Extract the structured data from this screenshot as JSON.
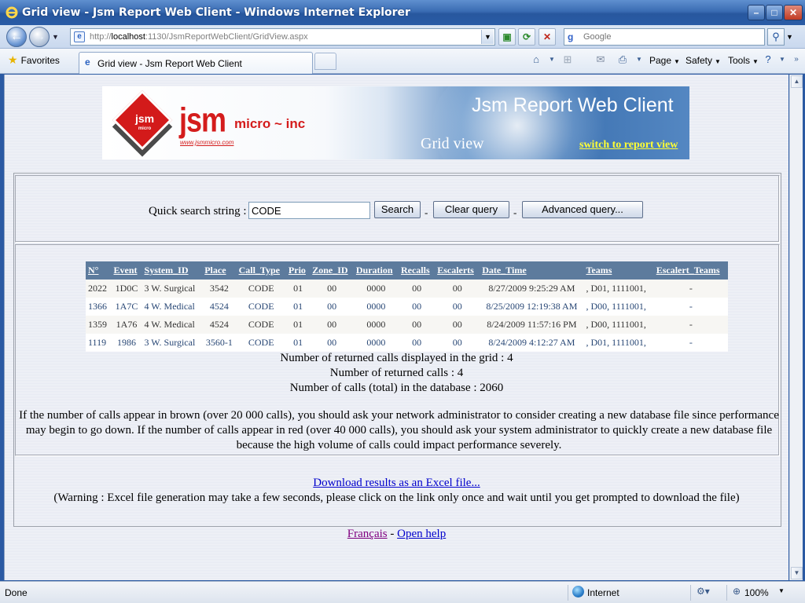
{
  "window": {
    "title": "Grid view - Jsm Report Web Client - Windows Internet Explorer",
    "minimize": "–",
    "maximize": "□",
    "close": "✕"
  },
  "nav": {
    "url_prefix": "http://",
    "url_host": "localhost",
    "url_rest": ":1130/JsmReportWebClient/GridView.aspx",
    "search_placeholder": "Google"
  },
  "commandbar": {
    "favorites": "Favorites",
    "tab_label": "Grid view - Jsm Report Web Client",
    "page": "Page",
    "safety": "Safety",
    "tools": "Tools"
  },
  "banner": {
    "brand_small": "jsm",
    "brand_micro_small": "micro",
    "brand": "jsm",
    "brand_suffix": "micro ~ inc",
    "brand_url": "www.jsmmicro.com",
    "title": "Jsm Report Web Client",
    "subtitle": "Grid view",
    "switch_link": "switch to report view"
  },
  "search": {
    "label": "Quick search string :",
    "value": "CODE",
    "search_button": "Search",
    "clear_button": "Clear query",
    "advanced_button": "Advanced query...",
    "separator": "-"
  },
  "grid": {
    "columns": [
      "N°",
      "Event",
      "System_ID",
      "Place",
      "Call_Type",
      "Prio",
      "Zone_ID",
      "Duration",
      "Recalls",
      "Escalerts",
      "Date_Time",
      "Teams",
      "Escalert_Teams"
    ],
    "rows": [
      [
        "2022",
        "1D0C",
        "3 W. Surgical",
        "3542",
        "CODE",
        "01",
        "00",
        "0000",
        "00",
        "00",
        "8/27/2009 9:25:29 AM",
        ", D01, 1111001,",
        "-"
      ],
      [
        "1366",
        "1A7C",
        "4 W. Medical",
        "4524",
        "CODE",
        "01",
        "00",
        "0000",
        "00",
        "00",
        "8/25/2009 12:19:38 AM",
        ", D00, 1111001,",
        "-"
      ],
      [
        "1359",
        "1A76",
        "4 W. Medical",
        "4524",
        "CODE",
        "01",
        "00",
        "0000",
        "00",
        "00",
        "8/24/2009 11:57:16 PM",
        ", D00, 1111001,",
        "-"
      ],
      [
        "1119",
        "1986",
        "3 W. Surgical",
        "3560-1",
        "CODE",
        "01",
        "00",
        "0000",
        "00",
        "00",
        "8/24/2009 4:12:27 AM",
        ", D01, 1111001,",
        "-"
      ]
    ]
  },
  "summary": {
    "displayed": "Number of returned calls displayed in the grid : 4",
    "returned": "Number of returned calls : 4",
    "total": "Number of calls (total) in the database : 2060",
    "warning": "If the number of calls appear in brown (over 20 000 calls), you should ask your network administrator to consider creating a new database file since performance may begin to go down. If the number of calls appear in red (over 40 000 calls), you should ask your system administrator to quickly create a new database file because the high volume of calls could impact performance severely."
  },
  "download": {
    "link": "Download results as an Excel file...",
    "warning": "(Warning : Excel file generation may take a few seconds, please click on the link only once and wait until you get prompted to download the file)"
  },
  "footer": {
    "french": "Français",
    "separator": "-",
    "help": "Open help"
  },
  "status": {
    "text": "Done",
    "zone": "Internet",
    "zoom": "100%"
  }
}
